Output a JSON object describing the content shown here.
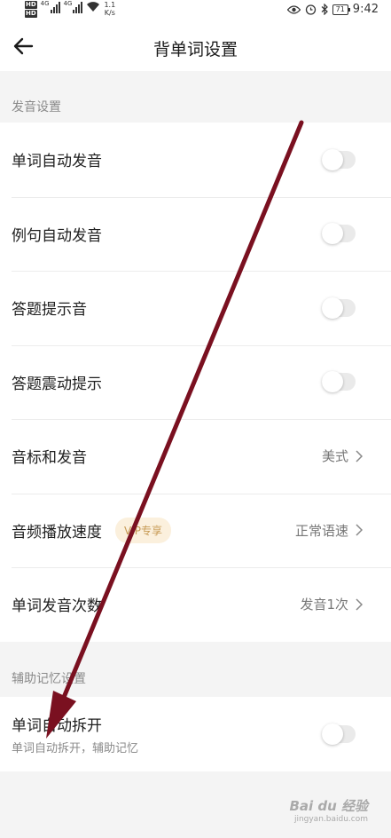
{
  "status_bar": {
    "hd_top": "HD",
    "hd_bottom": "HD",
    "net_type_1": "4G",
    "net_type_2": "4G",
    "net_speed": "1.1",
    "net_speed_unit": "K/s",
    "battery": "71",
    "time": "9:42"
  },
  "header": {
    "title": "背单词设置"
  },
  "sections": [
    {
      "title": "发音设置",
      "items": [
        {
          "label": "单词自动发音",
          "toggle_on": false
        },
        {
          "label": "例句自动发音",
          "toggle_on": false
        },
        {
          "label": "答题提示音",
          "toggle_on": false
        },
        {
          "label": "答题震动提示",
          "toggle_on": false
        },
        {
          "label": "音标和发音",
          "value": "美式"
        },
        {
          "label": "音频播放速度",
          "badge": "VIP专享",
          "value": "正常语速"
        },
        {
          "label": "单词发音次数",
          "value": "发音1次"
        }
      ]
    },
    {
      "title": "辅助记忆设置",
      "items": [
        {
          "label": "单词自动拆开",
          "sublabel": "单词自动拆开，辅助记忆",
          "toggle_on": false
        }
      ]
    }
  ],
  "watermark": {
    "brand": "Bai du 经验",
    "url": "jingyan.baidu.com"
  },
  "colors": {
    "annotation_arrow": "#7a1020",
    "toggle_track_off": "#eaeaea",
    "vip_badge_bg": "#fbf0dd",
    "vip_badge_text": "#c79a54"
  }
}
